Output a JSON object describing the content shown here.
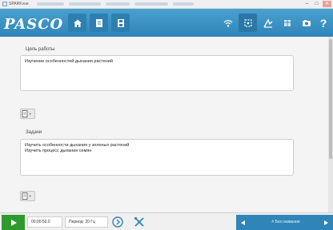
{
  "window": {
    "title": "SPARKvue",
    "minimize_glyph": "–",
    "maximize_glyph": "□",
    "close_glyph": "✕"
  },
  "toolbar": {
    "logo": "PASCO",
    "left_buttons": [
      "home-icon",
      "journal-icon",
      "save-icon"
    ],
    "right_buttons": [
      "wireless-icon",
      "sensor-data-icon",
      "analysis-icon",
      "table-icon",
      "camera-icon"
    ],
    "help_label": "?",
    "accent": "#2f85b8"
  },
  "main": {
    "goal": {
      "label": "Цель работы",
      "lines": [
        "Изучение особенностей дыхания растений"
      ]
    },
    "tasks": {
      "label": "Задачи",
      "lines": [
        "Изучить особенности дыхания у зеленых растений",
        "Изучить процесс дыхания семян"
      ]
    },
    "insert_icon": "insert-template-icon"
  },
  "controls": {
    "play_icon": "play-icon",
    "elapsed_time": "00:00:50.0",
    "sample_rate": "Период: 20 Гц",
    "page_name": "# Без названия",
    "status_colors": {
      "play": "#2e9a2e"
    }
  }
}
